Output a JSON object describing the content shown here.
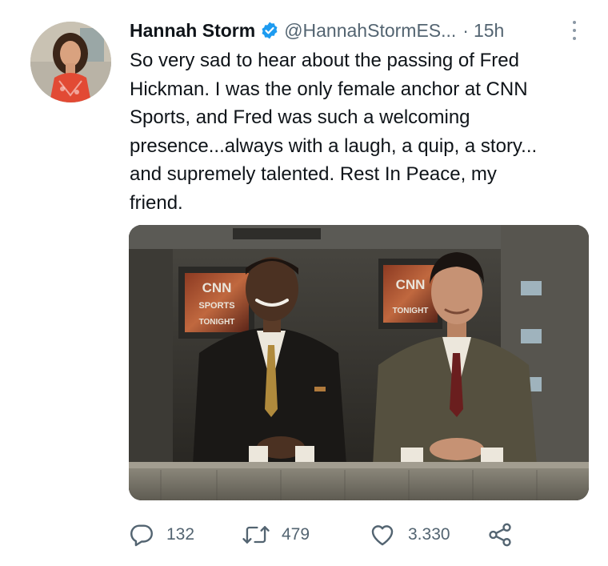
{
  "tweet": {
    "author_name": "Hannah Storm",
    "handle": "@HannahStormES...",
    "separator": "·",
    "time": "15h",
    "text_lines": [
      "So very sad to hear about the passing of Fred",
      "Hickman. I was the only female anchor at CNN",
      "Sports, and Fred was such a welcoming",
      "presence...always with a laugh, a quip, a story...",
      "and supremely talented. Rest In Peace, my",
      "friend."
    ],
    "media_text": {
      "screen_left_top": "CNN",
      "screen_left_mid": "SPORTS",
      "screen_left_bottom": "TONIGHT",
      "screen_right_top": "CNN",
      "screen_right_bottom": "TONIGHT"
    }
  },
  "actions": {
    "reply": {
      "icon": "reply-icon",
      "count": "132"
    },
    "retweet": {
      "icon": "retweet-icon",
      "count": "479"
    },
    "like": {
      "icon": "heart-icon",
      "count": "3.330"
    },
    "share": {
      "icon": "share-icon"
    }
  },
  "colors": {
    "text": "#0f1419",
    "secondary": "#536471",
    "verified": "#1d9bf0"
  }
}
